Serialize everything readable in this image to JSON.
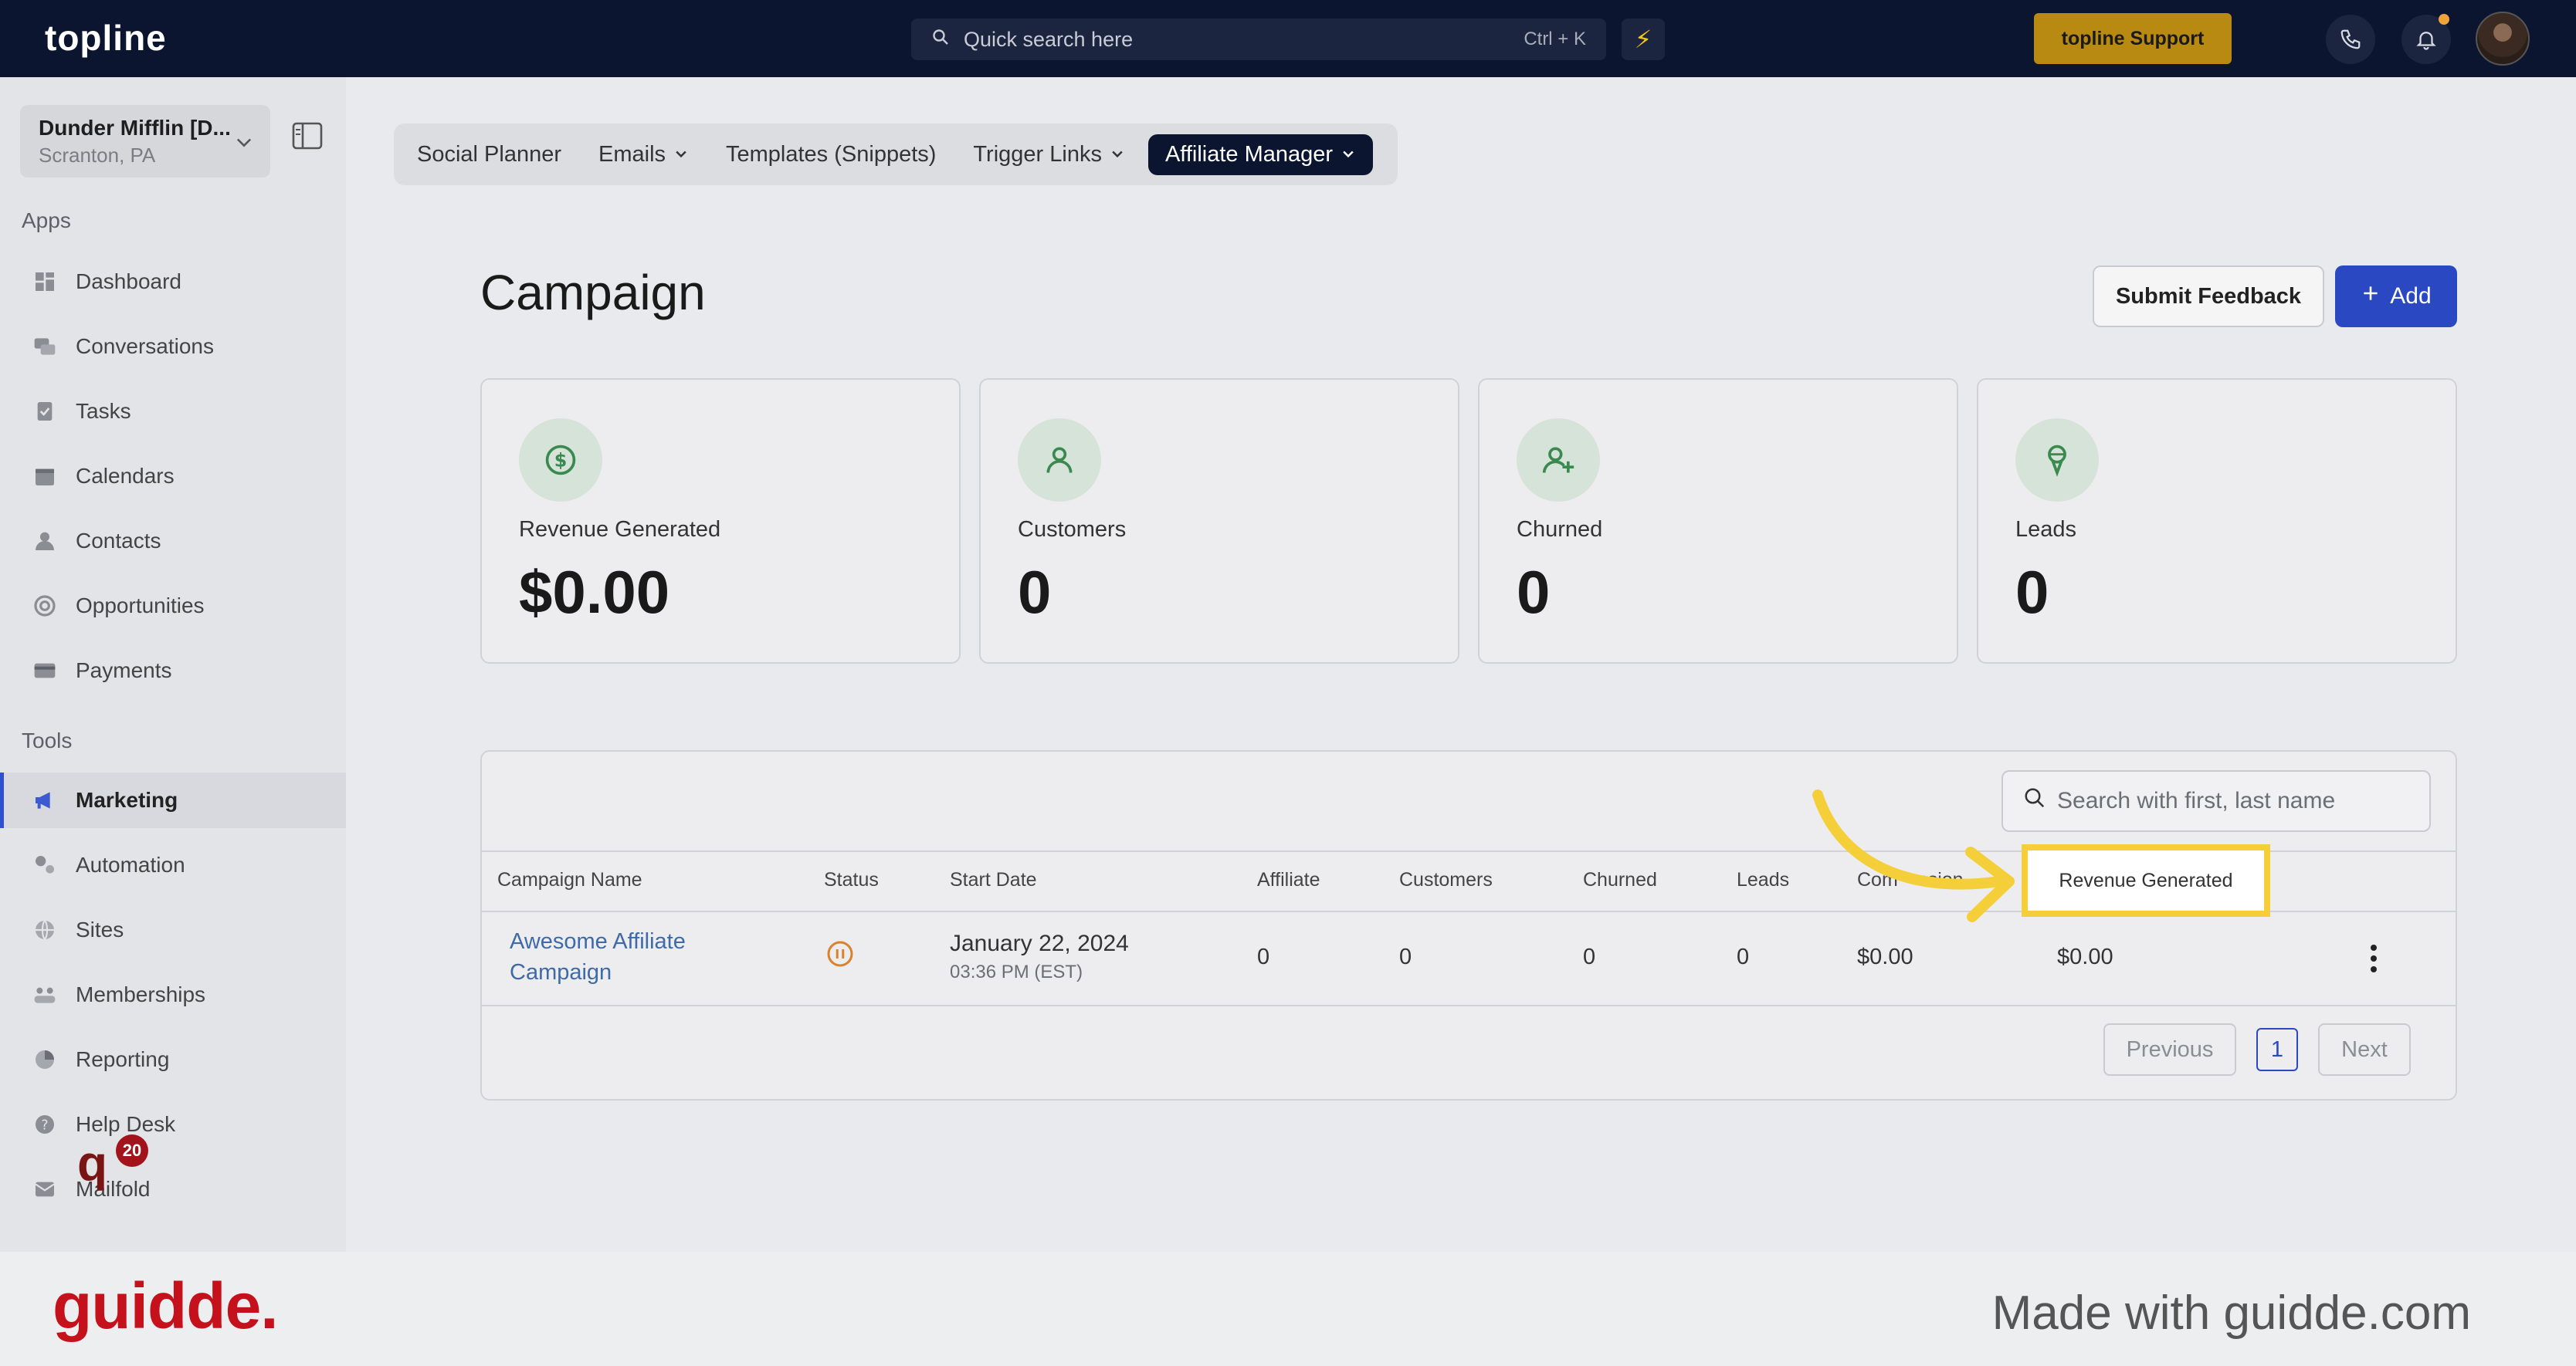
{
  "topbar": {
    "logo": "topline",
    "search_placeholder": "Quick search here",
    "search_shortcut": "Ctrl + K",
    "support_button": "topline Support",
    "icons": [
      "search-icon",
      "bolt-icon",
      "phone-icon",
      "bell-icon",
      "avatar"
    ]
  },
  "sidebar": {
    "location_name": "Dunder Mifflin [D...",
    "location_city": "Scranton, PA",
    "apps_label": "Apps",
    "tools_label": "Tools",
    "apps": [
      {
        "label": "Dashboard",
        "icon": "dashboard-icon"
      },
      {
        "label": "Conversations",
        "icon": "chat-icon"
      },
      {
        "label": "Tasks",
        "icon": "tasks-icon"
      },
      {
        "label": "Calendars",
        "icon": "calendar-icon"
      },
      {
        "label": "Contacts",
        "icon": "contact-icon"
      },
      {
        "label": "Opportunities",
        "icon": "target-icon"
      },
      {
        "label": "Payments",
        "icon": "card-icon"
      }
    ],
    "tools": [
      {
        "label": "Marketing",
        "icon": "megaphone-icon",
        "active": true
      },
      {
        "label": "Automation",
        "icon": "gears-icon"
      },
      {
        "label": "Sites",
        "icon": "globe-icon"
      },
      {
        "label": "Memberships",
        "icon": "members-icon"
      },
      {
        "label": "Reporting",
        "icon": "pie-icon"
      },
      {
        "label": "Help Desk",
        "icon": "help-icon"
      },
      {
        "label": "Mailfold",
        "icon": "mail-icon"
      }
    ],
    "badge_count": "20"
  },
  "tabs": {
    "social_planner": "Social Planner",
    "emails": "Emails",
    "templates": "Templates (Snippets)",
    "trigger_links": "Trigger Links",
    "affiliate_manager": "Affiliate Manager"
  },
  "page": {
    "title": "Campaign",
    "submit_feedback": "Submit Feedback",
    "add": "Add"
  },
  "stats": [
    {
      "label": "Revenue Generated",
      "value": "$0.00",
      "icon": "dollar-icon"
    },
    {
      "label": "Customers",
      "value": "0",
      "icon": "user-icon"
    },
    {
      "label": "Churned",
      "value": "0",
      "icon": "user-plus-icon"
    },
    {
      "label": "Leads",
      "value": "0",
      "icon": "funnel-icon"
    }
  ],
  "table": {
    "search_placeholder": "Search with first, last name",
    "headers": {
      "campaign_name": "Campaign Name",
      "status": "Status",
      "start_date": "Start Date",
      "affiliate": "Affiliate",
      "customers": "Customers",
      "churned": "Churned",
      "leads": "Leads",
      "commission_visible": "Com",
      "commission_tail": "ssion",
      "revenue_generated": "Revenue Generated"
    },
    "row": {
      "campaign_name": "Awesome Affiliate Campaign",
      "status": "paused",
      "start_date": "January 22, 2024",
      "start_time": "03:36 PM (EST)",
      "affiliate": "0",
      "customers": "0",
      "churned": "0",
      "leads": "0",
      "commission": "$0.00",
      "revenue": "$0.00"
    },
    "pagination": {
      "previous": "Previous",
      "page": "1",
      "next": "Next"
    }
  },
  "footer": {
    "logo": "guidde.",
    "tagline": "Made with guidde.com"
  },
  "colors": {
    "topbar": "#0b1530",
    "primary": "#2a48c2",
    "support": "#b88a12",
    "highlight": "#f4cf3a",
    "brand_red": "#c5111b"
  }
}
